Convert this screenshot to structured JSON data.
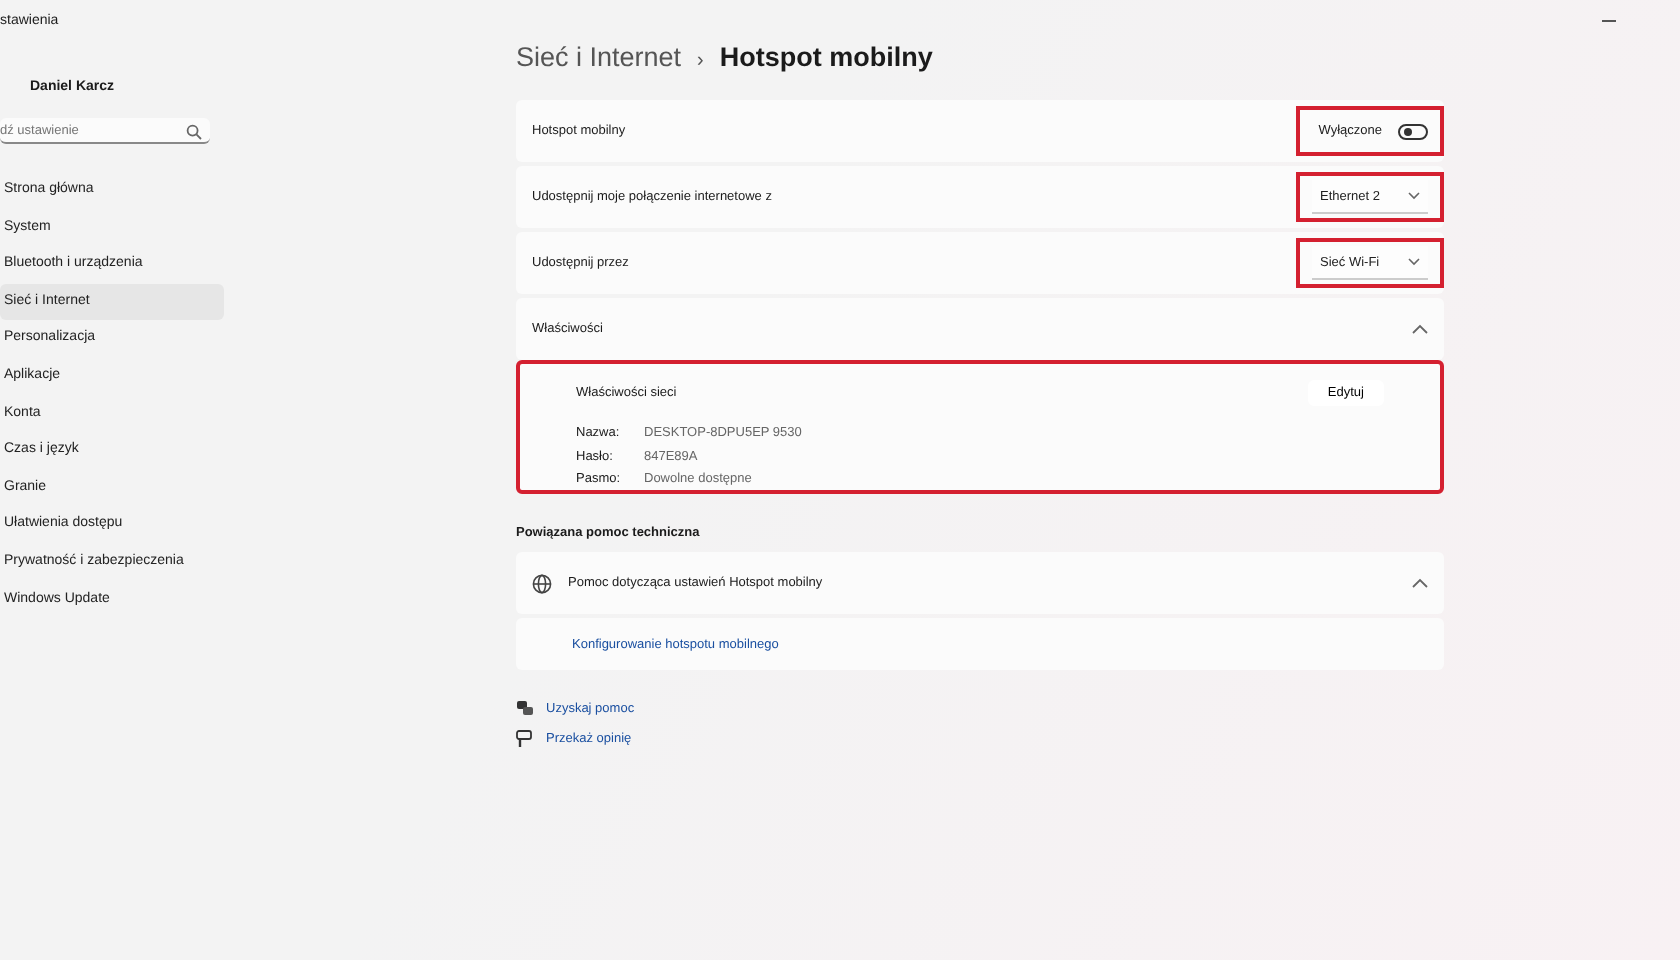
{
  "window": {
    "title": "stawienia"
  },
  "user": {
    "name": "Daniel Karcz"
  },
  "search": {
    "placeholder": "dź ustawienie"
  },
  "sidebar": {
    "items": [
      {
        "label": "Strona główna",
        "selected": false
      },
      {
        "label": "System",
        "selected": false
      },
      {
        "label": "Bluetooth i urządzenia",
        "selected": false
      },
      {
        "label": "Sieć i Internet",
        "selected": true
      },
      {
        "label": "Personalizacja",
        "selected": false
      },
      {
        "label": "Aplikacje",
        "selected": false
      },
      {
        "label": "Konta",
        "selected": false
      },
      {
        "label": "Czas i język",
        "selected": false
      },
      {
        "label": "Granie",
        "selected": false
      },
      {
        "label": "Ułatwienia dostępu",
        "selected": false
      },
      {
        "label": "Prywatność i zabezpieczenia",
        "selected": false
      },
      {
        "label": "Windows Update",
        "selected": false
      }
    ]
  },
  "breadcrumb": {
    "parent": "Sieć i Internet",
    "separator": "›",
    "current": "Hotspot mobilny"
  },
  "settings": [
    {
      "kind": "toggle",
      "label": "Hotspot mobilny",
      "value": "Wyłączone",
      "on": false,
      "highlighted": true
    },
    {
      "kind": "dropdown",
      "label": "Udostępnij moje połączenie internetowe z",
      "value": "Ethernet 2",
      "highlighted": true
    },
    {
      "kind": "dropdown",
      "label": "Udostępnij przez",
      "value": "Sieć Wi-Fi",
      "highlighted": true
    }
  ],
  "properties": {
    "label": "Właściwości",
    "expanded": true,
    "highlighted": true,
    "title": "Właściwości sieci",
    "button": "Edytuj",
    "fields": [
      {
        "name": "Nazwa:",
        "value": "DESKTOP-8DPU5EP 9530"
      },
      {
        "name": "Hasło:",
        "value": "847E89A"
      },
      {
        "name": "Pasmo:",
        "value": "Dowolne dostępne"
      }
    ]
  },
  "related": {
    "heading": "Powiązana pomoc techniczna",
    "label": "Pomoc dotycząca ustawień Hotspot mobilny",
    "expanded": true,
    "links": [
      "Konfigurowanie hotspotu mobilnego"
    ]
  },
  "footer_links": [
    {
      "kind": "help",
      "label": "Uzyskaj pomoc"
    },
    {
      "kind": "feedback",
      "label": "Przekaż opinię"
    }
  ]
}
